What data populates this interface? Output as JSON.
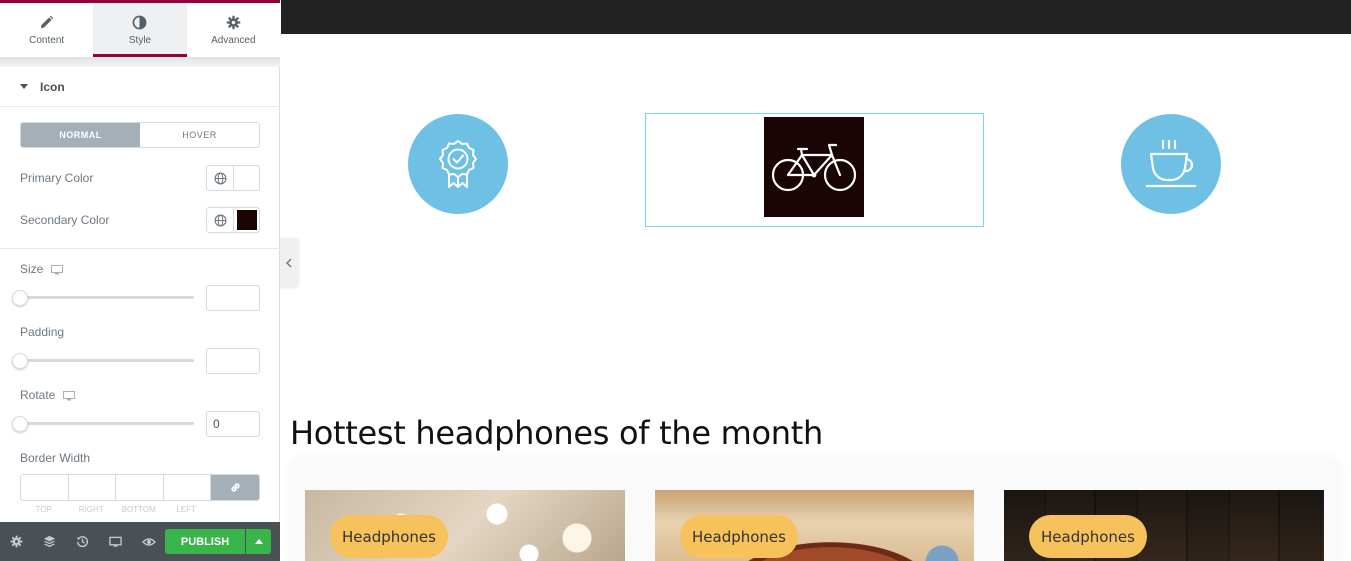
{
  "panel": {
    "tabs": [
      {
        "label": "Content",
        "icon": "pencil-icon"
      },
      {
        "label": "Style",
        "icon": "half-circle-icon"
      },
      {
        "label": "Advanced",
        "icon": "gear-icon"
      }
    ],
    "active_tab": "Style",
    "section": "Icon",
    "state_toggle": {
      "normal": "NORMAL",
      "hover": "HOVER",
      "active": "NORMAL"
    },
    "primary_color": {
      "label": "Primary Color",
      "value": "#ffffff"
    },
    "secondary_color": {
      "label": "Secondary Color",
      "value": "#1b0404"
    },
    "size": {
      "label": "Size",
      "value": ""
    },
    "padding": {
      "label": "Padding",
      "value": ""
    },
    "rotate": {
      "label": "Rotate",
      "value": "0"
    },
    "border_width": {
      "label": "Border Width",
      "sides": [
        "TOP",
        "RIGHT",
        "BOTTOM",
        "LEFT"
      ]
    },
    "footer": {
      "icons": [
        "settings-icon",
        "layers-icon",
        "history-icon",
        "responsive-icon",
        "preview-icon"
      ],
      "publish": "PUBLISH"
    },
    "accent": "#93003c"
  },
  "preview": {
    "icon_circle_color": "#6ec1e4",
    "icons": [
      "award-badge-icon",
      "bicycle-icon",
      "coffee-cup-icon"
    ],
    "headline": "Hottest headphones of the month",
    "cards": [
      {
        "badge": "Headphones"
      },
      {
        "badge": "Headphones"
      },
      {
        "badge": "Headphones"
      }
    ],
    "badge_color": "#f7c25c"
  }
}
